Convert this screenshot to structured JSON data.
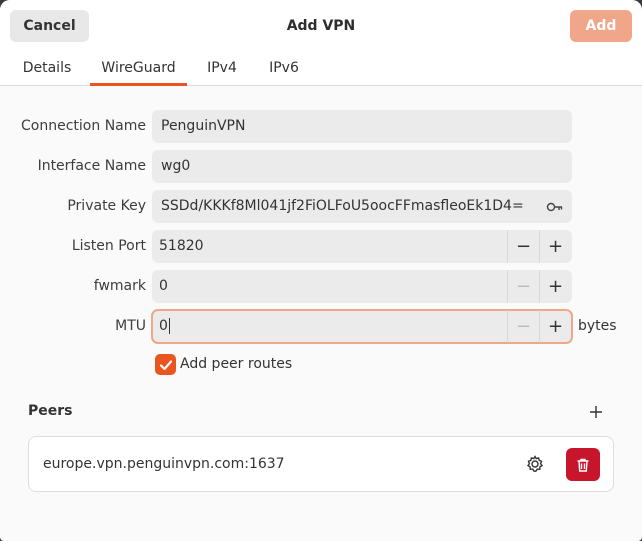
{
  "header": {
    "cancel_label": "Cancel",
    "title": "Add VPN",
    "add_label": "Add"
  },
  "tabs": [
    {
      "label": "Details",
      "active": false
    },
    {
      "label": "WireGuard",
      "active": true
    },
    {
      "label": "IPv4",
      "active": false
    },
    {
      "label": "IPv6",
      "active": false
    }
  ],
  "form": {
    "connection_name": {
      "label": "Connection Name",
      "value": "PenguinVPN"
    },
    "interface_name": {
      "label": "Interface Name",
      "value": "wg0"
    },
    "private_key": {
      "label": "Private Key",
      "value": "SSDd/KKKf8Ml041jf2FiOLFoU5oocFFmasfleoEk1D4=",
      "icon": "key-icon"
    },
    "listen_port": {
      "label": "Listen Port",
      "value": "51820"
    },
    "fwmark": {
      "label": "fwmark",
      "value": "0"
    },
    "mtu": {
      "label": "MTU",
      "value": "0",
      "unit": "bytes"
    },
    "add_peer_routes": {
      "label": "Add peer routes",
      "checked": true
    }
  },
  "peers": {
    "title": "Peers",
    "items": [
      {
        "name": "europe.vpn.penguinvpn.com:1637"
      }
    ]
  },
  "colors": {
    "accent": "#e95420",
    "add_disabled": "#f0a689",
    "destructive": "#c7162b"
  }
}
